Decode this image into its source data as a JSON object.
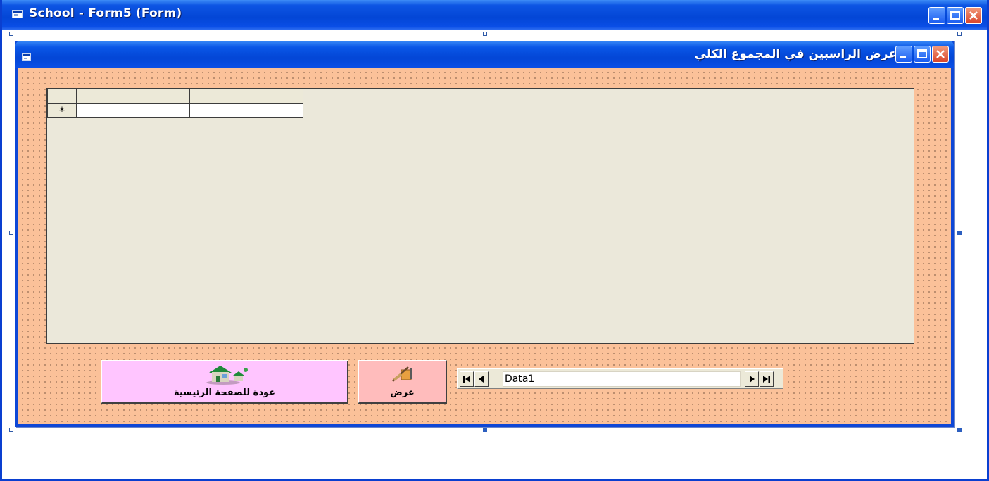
{
  "outer_window": {
    "title": "School - Form5 (Form)"
  },
  "form": {
    "title": "عرض الراسبين في المجموع الكلي",
    "grid": {
      "new_row_marker": "*"
    },
    "buttons": {
      "home_label": "عودة للصفحة الرئيسية",
      "show_label": "عرض"
    },
    "data_control": {
      "caption": "Data1"
    }
  },
  "colors": {
    "titlebar_blue": "#0346d6",
    "form_background": "#fbc199",
    "grid_background": "#ebe8da",
    "home_button": "#ffc5ff",
    "show_button": "#ffbcbc"
  },
  "icons": [
    "form-icon",
    "minimize-icon",
    "maximize-icon",
    "close-icon",
    "house-icon",
    "tool-icon",
    "first-record-icon",
    "prev-record-icon",
    "next-record-icon",
    "last-record-icon"
  ]
}
